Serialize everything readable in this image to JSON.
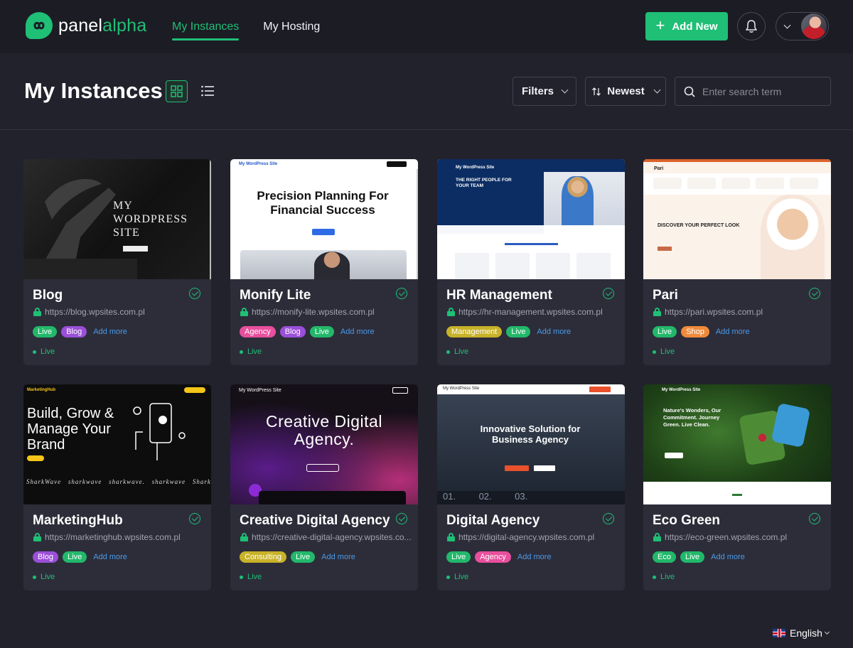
{
  "brand": {
    "name_part1": "panel",
    "name_part2": "alpha",
    "accent": "#1fbf75"
  },
  "nav": {
    "items": [
      {
        "label": "My Instances",
        "active": true
      },
      {
        "label": "My Hosting",
        "active": false
      }
    ]
  },
  "header": {
    "add_new_label": "Add New",
    "icons": [
      "bell-icon",
      "chevron-down-icon",
      "avatar"
    ]
  },
  "page": {
    "title": "My Instances",
    "filters_label": "Filters",
    "sort_label": "Newest",
    "search_placeholder": "Enter search term"
  },
  "instances": [
    {
      "name": "Blog",
      "url": "https://blog.wpsites.com.pl",
      "tags": [
        {
          "label": "Live",
          "color": "#22b86a"
        },
        {
          "label": "Blog",
          "color": "#9b4fd9"
        }
      ],
      "add_more": "Add more",
      "status": "Live",
      "preview": {
        "headline": "MY WORDPRESS SITE"
      }
    },
    {
      "name": "Monify Lite",
      "url": "https://monify-lite.wpsites.com.pl",
      "tags": [
        {
          "label": "Agency",
          "color": "#e84f9d"
        },
        {
          "label": "Blog",
          "color": "#9b4fd9"
        },
        {
          "label": "Live",
          "color": "#22b86a"
        }
      ],
      "add_more": "Add more",
      "status": "Live",
      "preview": {
        "site": "My WordPress Site",
        "headline": "Precision Planning For Financial Success"
      }
    },
    {
      "name": "HR Management",
      "url": "https://hr-management.wpsites.com.pl",
      "tags": [
        {
          "label": "Management",
          "color": "#c8b227"
        },
        {
          "label": "Live",
          "color": "#22b86a"
        }
      ],
      "add_more": "Add more",
      "status": "Live",
      "preview": {
        "site": "My WordPress Site",
        "headline": "THE RIGHT PEOPLE FOR YOUR TEAM"
      }
    },
    {
      "name": "Pari",
      "url": "https://pari.wpsites.com.pl",
      "tags": [
        {
          "label": "Live",
          "color": "#22b86a"
        },
        {
          "label": "Shop",
          "color": "#ef8a3a"
        }
      ],
      "add_more": "Add more",
      "status": "Live",
      "preview": {
        "site": "Pari",
        "headline": "DISCOVER YOUR PERFECT LOOK"
      }
    },
    {
      "name": "MarketingHub",
      "url": "https://marketinghub.wpsites.com.pl",
      "tags": [
        {
          "label": "Blog",
          "color": "#9b4fd9"
        },
        {
          "label": "Live",
          "color": "#22b86a"
        }
      ],
      "add_more": "Add more",
      "status": "Live",
      "preview": {
        "site": "MarketingHub",
        "headline": "Build, Grow & Manage Your Brand"
      }
    },
    {
      "name": "Creative Digital Agency",
      "url": "https://creative-digital-agency.wpsites.co...",
      "tags": [
        {
          "label": "Consulting",
          "color": "#c8b227"
        },
        {
          "label": "Live",
          "color": "#22b86a"
        }
      ],
      "add_more": "Add more",
      "status": "Live",
      "preview": {
        "site": "My WordPress Site",
        "headline": "Creative Digital Agency."
      }
    },
    {
      "name": "Digital Agency",
      "url": "https://digital-agency.wpsites.com.pl",
      "tags": [
        {
          "label": "Live",
          "color": "#22b86a"
        },
        {
          "label": "Agency",
          "color": "#e84f9d"
        }
      ],
      "add_more": "Add more",
      "status": "Live",
      "preview": {
        "site": "My WordPress Site",
        "headline": "Innovative Solution for Business Agency"
      }
    },
    {
      "name": "Eco Green",
      "url": "https://eco-green.wpsites.com.pl",
      "tags": [
        {
          "label": "Eco",
          "color": "#22b86a"
        },
        {
          "label": "Live",
          "color": "#22b86a"
        }
      ],
      "add_more": "Add more",
      "status": "Live",
      "preview": {
        "site": "My WordPress Site",
        "headline": "Nature's Wonders, Our Commitment. Journey Green. Live Clean."
      }
    }
  ],
  "footer": {
    "language": "English"
  }
}
